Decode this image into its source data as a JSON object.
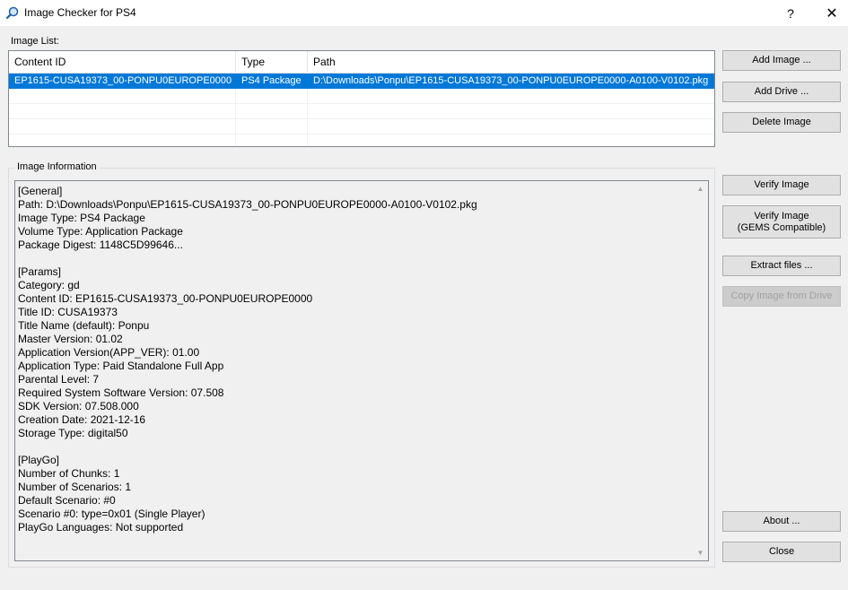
{
  "window": {
    "title": "Image Checker for PS4",
    "help_glyph": "?",
    "close_glyph": "✕"
  },
  "image_list": {
    "label": "Image List:",
    "columns": [
      "Content ID",
      "Type",
      "Path"
    ],
    "rows": [
      [
        "EP1615-CUSA19373_00-PONPU0EUROPE0000",
        "PS4 Package",
        "D:\\Downloads\\Ponpu\\EP1615-CUSA19373_00-PONPU0EUROPE0000-A0100-V0102.pkg"
      ]
    ]
  },
  "image_info": {
    "label": "Image Information",
    "lines": [
      "[General]",
      "Path: D:\\Downloads\\Ponpu\\EP1615-CUSA19373_00-PONPU0EUROPE0000-A0100-V0102.pkg",
      "Image Type: PS4 Package",
      "Volume Type: Application Package",
      "Package Digest: 1148C5D99646...",
      "",
      "[Params]",
      "Category: gd",
      "Content ID: EP1615-CUSA19373_00-PONPU0EUROPE0000",
      "Title ID: CUSA19373",
      "Title Name (default): Ponpu",
      "Master Version: 01.02",
      "Application Version(APP_VER): 01.00",
      "Application Type: Paid Standalone Full App",
      "Parental Level: 7",
      "Required System Software Version: 07.508",
      "SDK Version: 07.508.000",
      "Creation Date: 2021-12-16",
      "Storage Type: digital50",
      "",
      "[PlayGo]",
      "Number of Chunks: 1",
      "Number of Scenarios: 1",
      "Default Scenario: #0",
      "Scenario #0: type=0x01 (Single Player)",
      "PlayGo Languages: Not supported"
    ]
  },
  "buttons": {
    "add_image": "Add Image ...",
    "add_drive": "Add Drive ...",
    "delete_image": "Delete Image",
    "verify_image": "Verify Image",
    "verify_gems_line1": "Verify Image",
    "verify_gems_line2": "(GEMS Compatible)",
    "extract_files": "Extract files ...",
    "copy_from_drive": "Copy Image from Drive",
    "about": "About ...",
    "close": "Close"
  }
}
